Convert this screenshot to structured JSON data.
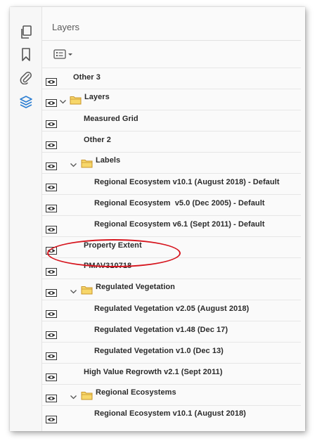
{
  "panel": {
    "title": "Layers",
    "options_icon": "options-menu-icon"
  },
  "rail": {
    "icons": [
      "pages-icon",
      "bookmark-icon",
      "attachment-icon",
      "layers-icon"
    ],
    "active_icon": "layers-icon",
    "active_color": "#2d7fd3"
  },
  "layers": [
    {
      "label": "Other 3"
    },
    {
      "label": "Layers"
    },
    {
      "label": "Measured Grid"
    },
    {
      "label": "Other 2"
    },
    {
      "label": "Labels"
    },
    {
      "label": "Regional Ecosystem v10.1 (August 2018) - Default"
    },
    {
      "label": "Regional Ecosystem  v5.0 (Dec 2005) - Default"
    },
    {
      "label": "Regional Ecosystem v6.1 (Sept 2011) - Default"
    },
    {
      "label": "Property Extent"
    },
    {
      "label": "PMAV310718"
    },
    {
      "label": "Regulated Vegetation"
    },
    {
      "label": "Regulated Vegetation v2.05 (August 2018)"
    },
    {
      "label": "Regulated Vegetation v1.48 (Dec 17)"
    },
    {
      "label": "Regulated Vegetation v1.0 (Dec 13)"
    },
    {
      "label": "High Value Regrowth v2.1 (Sept 2011)"
    },
    {
      "label": "Regional Ecosystems"
    },
    {
      "label": "Regional Ecosystem v10.1 (August 2018)"
    }
  ],
  "colors": {
    "highlight": "#d6141d",
    "folder": "#f2c237",
    "text": "#2b2b2b"
  }
}
